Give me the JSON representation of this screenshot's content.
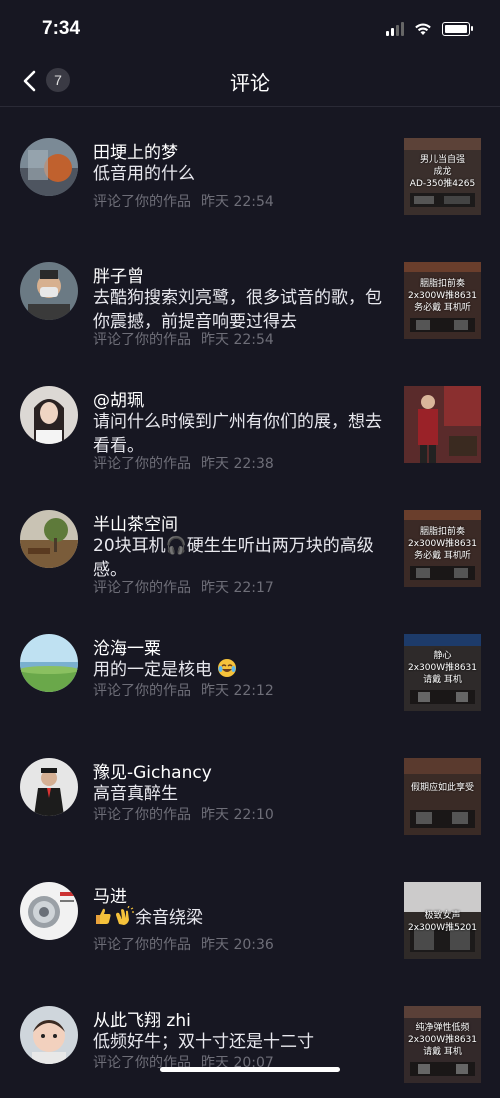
{
  "status_bar": {
    "time": "7:34"
  },
  "nav": {
    "title": "评论",
    "badge_count": "7"
  },
  "comments": [
    {
      "name": "田埂上的梦",
      "text": "低音用的什么",
      "action": "评论了你的作品",
      "time": "昨天 22:54",
      "thumb_text": "男儿当自强\n成龙\nAD-350推4265"
    },
    {
      "name": "胖子曾",
      "text": "去酷狗搜索刘亮鹭，很多试音的歌，包你震撼，前提音响要过得去",
      "action": "评论了你的作品",
      "time": "昨天 22:54",
      "thumb_text": "胭脂扣前奏\n2x300W推8631\n务必戴 耳机听"
    },
    {
      "name": "@胡珮",
      "text": "请问什么时候到广州有你们的展，想去看看。",
      "action": "评论了你的作品",
      "time": "昨天 22:38",
      "thumb_text": ""
    },
    {
      "name": "半山茶空间",
      "text": "20块耳机🎧硬生生听出两万块的高级感。",
      "action": "评论了你的作品",
      "time": "昨天 22:17",
      "thumb_text": "胭脂扣前奏\n2x300W推8631\n务必戴 耳机听"
    },
    {
      "name": "沧海一粟",
      "text": "用的一定是核电",
      "action": "评论了你的作品",
      "time": "昨天 22:12",
      "thumb_text": "静心\n2x300W推8631\n请戴 耳机"
    },
    {
      "name": "豫见-Gichancy",
      "text": "高音真醉生",
      "action": "评论了你的作品",
      "time": "昨天 22:10",
      "thumb_text": "假期应如此享受"
    },
    {
      "name": "马进",
      "text": "余音绕梁",
      "action": "评论了你的作品",
      "time": "昨天 20:36",
      "thumb_text": "极致女声\n2x300W推5201"
    },
    {
      "name": "从此飞翔 zhi",
      "text": "低频好牛；双十寸还是十二寸",
      "action": "评论了你的作品",
      "time": "昨天 20:07",
      "thumb_text": "纯净弹性低频\n2x300W推8631\n请戴 耳机"
    }
  ],
  "icons": {
    "back": "chevron-left-icon",
    "wifi": "wifi-icon",
    "signal": "signal-icon",
    "battery": "battery-icon"
  }
}
